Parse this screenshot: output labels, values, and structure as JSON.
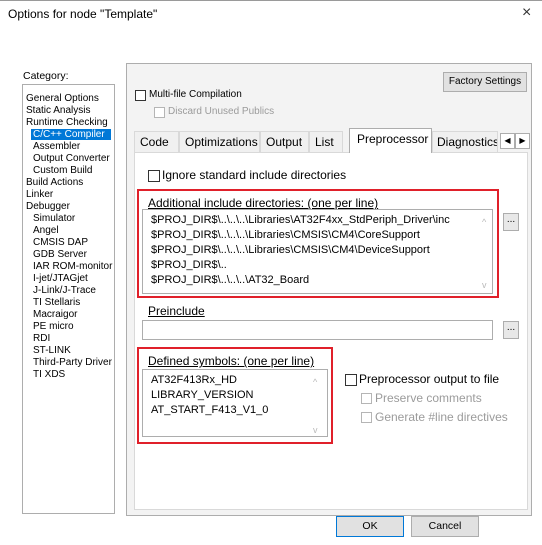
{
  "window": {
    "title": "Options for node \"Template\"",
    "close_label": "×"
  },
  "category": {
    "label": "Category:",
    "items": [
      {
        "label": "General Options",
        "indent": false
      },
      {
        "label": "Static Analysis",
        "indent": false
      },
      {
        "label": "Runtime Checking",
        "indent": false
      },
      {
        "label": "C/C++ Compiler",
        "indent": true,
        "selected": true
      },
      {
        "label": "Assembler",
        "indent": true
      },
      {
        "label": "Output Converter",
        "indent": true
      },
      {
        "label": "Custom Build",
        "indent": true
      },
      {
        "label": "Build Actions",
        "indent": false
      },
      {
        "label": "Linker",
        "indent": false
      },
      {
        "label": "Debugger",
        "indent": false
      },
      {
        "label": "Simulator",
        "indent": true
      },
      {
        "label": "Angel",
        "indent": true
      },
      {
        "label": "CMSIS DAP",
        "indent": true
      },
      {
        "label": "GDB Server",
        "indent": true
      },
      {
        "label": "IAR ROM-monitor",
        "indent": true
      },
      {
        "label": "I-jet/JTAGjet",
        "indent": true
      },
      {
        "label": "J-Link/J-Trace",
        "indent": true
      },
      {
        "label": "TI Stellaris",
        "indent": true
      },
      {
        "label": "Macraigor",
        "indent": true
      },
      {
        "label": "PE micro",
        "indent": true
      },
      {
        "label": "RDI",
        "indent": true
      },
      {
        "label": "ST-LINK",
        "indent": true
      },
      {
        "label": "Third-Party Driver",
        "indent": true
      },
      {
        "label": "TI XDS",
        "indent": true
      }
    ]
  },
  "panel": {
    "factory_settings": "Factory Settings",
    "multifile": "Multi-file Compilation",
    "discard": "Discard Unused Publics"
  },
  "tabs": [
    "Code",
    "Optimizations",
    "Output",
    "List",
    "Preprocessor",
    "Diagnostics"
  ],
  "tab_scroll": {
    "left": "◀",
    "right": "▶"
  },
  "preprocessor": {
    "ignore_std": "Ignore standard include directories",
    "include_label": "Additional include directories: (one per line)",
    "include_lines": [
      "$PROJ_DIR$\\..\\..\\..\\Libraries\\AT32F4xx_StdPeriph_Driver\\inc",
      "$PROJ_DIR$\\..\\..\\..\\Libraries\\CMSIS\\CM4\\CoreSupport",
      "$PROJ_DIR$\\..\\..\\..\\Libraries\\CMSIS\\CM4\\DeviceSupport",
      "$PROJ_DIR$\\..",
      "$PROJ_DIR$\\..\\..\\..\\AT32_Board"
    ],
    "browse_label": "...",
    "preinclude_label": "Preinclude",
    "preinclude_value": "",
    "defined_label": "Defined symbols: (one per line)",
    "defined_lines": [
      "AT32F413Rx_HD",
      "LIBRARY_VERSION",
      "AT_START_F413_V1_0"
    ],
    "pp_output": "Preprocessor output to file",
    "preserve_comments": "Preserve comments",
    "generate_line": "Generate #line directives"
  },
  "buttons": {
    "ok": "OK",
    "cancel": "Cancel"
  }
}
